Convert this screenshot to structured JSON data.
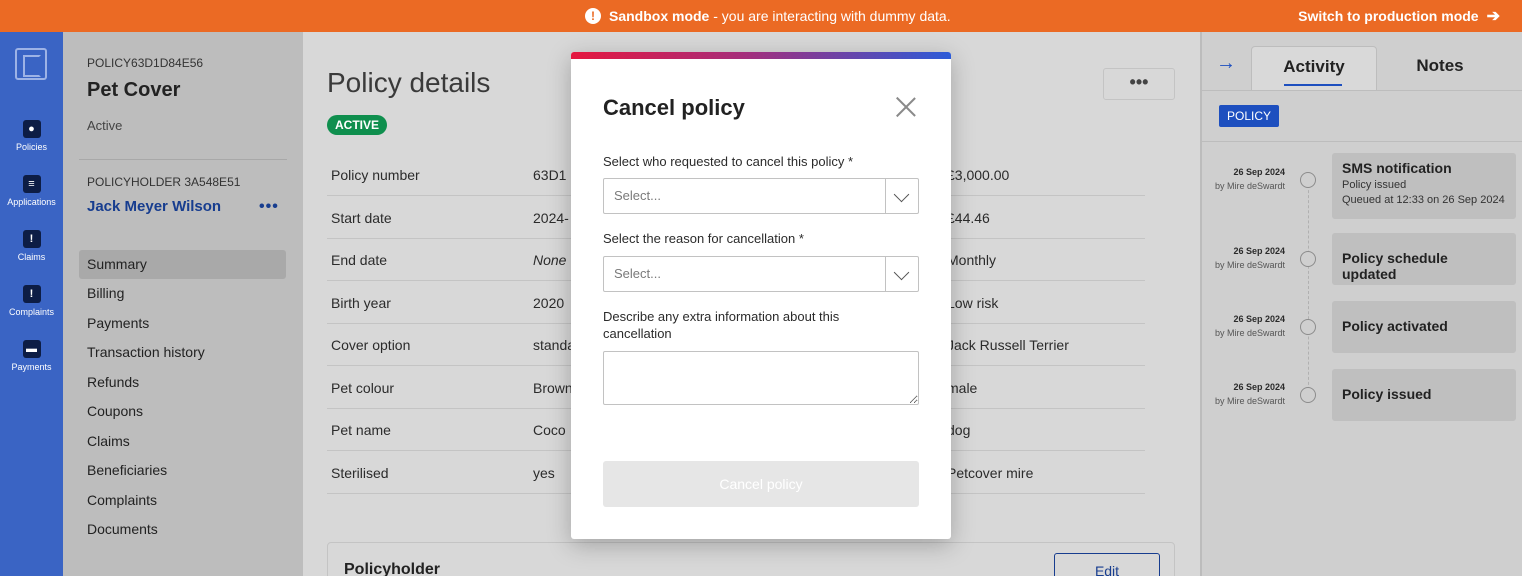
{
  "banner": {
    "icon": "exclamation-icon",
    "mode_strong": "Sandbox mode",
    "mode_text": " - you are interacting with dummy data.",
    "switch_label": "Switch to production mode",
    "switch_icon": "arrow-right-icon",
    "color": "#eb6a24"
  },
  "nav": {
    "items": [
      {
        "label": "Policies",
        "icon": "policies-icon"
      },
      {
        "label": "Applications",
        "icon": "applications-icon"
      },
      {
        "label": "Claims",
        "icon": "claims-icon"
      },
      {
        "label": "Complaints",
        "icon": "complaints-icon"
      },
      {
        "label": "Payments",
        "icon": "payments-icon"
      }
    ]
  },
  "sidebar": {
    "policy_ref": "POLICY63D1D84E56",
    "policy_name": "Pet Cover",
    "policy_status": "Active",
    "holder_ref": "POLICYHOLDER 3A548E51",
    "holder_name": "Jack Meyer Wilson",
    "holder_more": "•••",
    "menu": [
      "Summary",
      "Billing",
      "Payments",
      "Transaction history",
      "Refunds",
      "Coupons",
      "Claims",
      "Beneficiaries",
      "Complaints",
      "Documents"
    ],
    "active_menu": "Summary"
  },
  "main": {
    "title": "Policy details",
    "more": "•••",
    "status": "ACTIVE",
    "rows": [
      {
        "label": "Policy number",
        "value1": "63D1",
        "value2": "£3,000.00"
      },
      {
        "label": "Start date",
        "value1": "2024-",
        "value2": "£44.46"
      },
      {
        "label": "End date",
        "value1": "None",
        "value2": "Monthly"
      },
      {
        "label": "Birth year",
        "value1": "2020",
        "value2": "Low risk"
      },
      {
        "label": "Cover option",
        "value1": "standa",
        "value2": "Jack Russell Terrier"
      },
      {
        "label": "Pet colour",
        "value1": "Brown",
        "value2": "male"
      },
      {
        "label": "Pet name",
        "value1": "Coco",
        "value2": "dog"
      },
      {
        "label": "Sterilised",
        "value1": "yes",
        "value2": "Petcover mire"
      }
    ],
    "policyholder_title": "Policyholder",
    "edit_label": "Edit"
  },
  "panel": {
    "tabs": [
      "Activity",
      "Notes"
    ],
    "active_tab": "Activity",
    "chip": "POLICY",
    "activities": [
      {
        "date": "26 Sep 2024",
        "by": "by Mire deSwardt",
        "title": "SMS notification",
        "lines": [
          "Policy issued",
          "Queued at 12:33 on 26 Sep 2024"
        ]
      },
      {
        "date": "26 Sep 2024",
        "by": "by Mire deSwardt",
        "title": "Policy schedule updated",
        "lines": []
      },
      {
        "date": "26 Sep 2024",
        "by": "by Mire deSwardt",
        "title": "Policy activated",
        "lines": []
      },
      {
        "date": "26 Sep 2024",
        "by": "by Mire deSwardt",
        "title": "Policy issued",
        "lines": []
      }
    ]
  },
  "modal": {
    "title": "Cancel policy",
    "requester_label": "Select who requested to cancel this policy *",
    "requester_placeholder": "Select...",
    "reason_label": "Select the reason for cancellation *",
    "reason_placeholder": "Select...",
    "extra_label": "Describe any extra information about this cancellation",
    "extra_value": "",
    "submit_label": "Cancel policy"
  }
}
